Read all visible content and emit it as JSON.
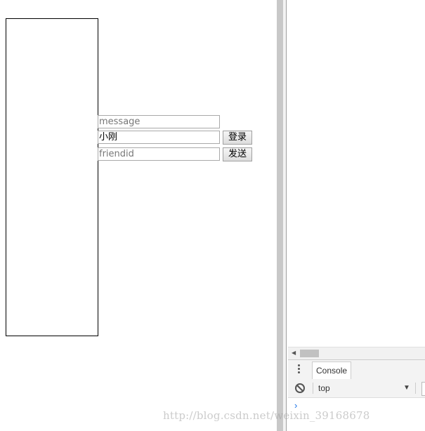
{
  "page": {
    "message_placeholder": "message",
    "username_value": "小刚",
    "friendid_placeholder": "friendid",
    "login_label": "登录",
    "send_label": "发送"
  },
  "devtools": {
    "tab_label": "Console",
    "context_label": "top",
    "prompt_symbol": "›",
    "icons": {
      "menu": "kebab-menu-icon",
      "clear": "clear-console-icon",
      "dropdown": "dropdown-arrow-icon",
      "scroll_left": "scroll-left-arrow-icon"
    }
  },
  "watermark": {
    "text": "http://blog.csdn.net/weixin_39168678"
  },
  "colors": {
    "prompt": "#1a73e8",
    "splitter": "#c8c8c8",
    "devtools_toolbar": "#f3f3f3"
  }
}
